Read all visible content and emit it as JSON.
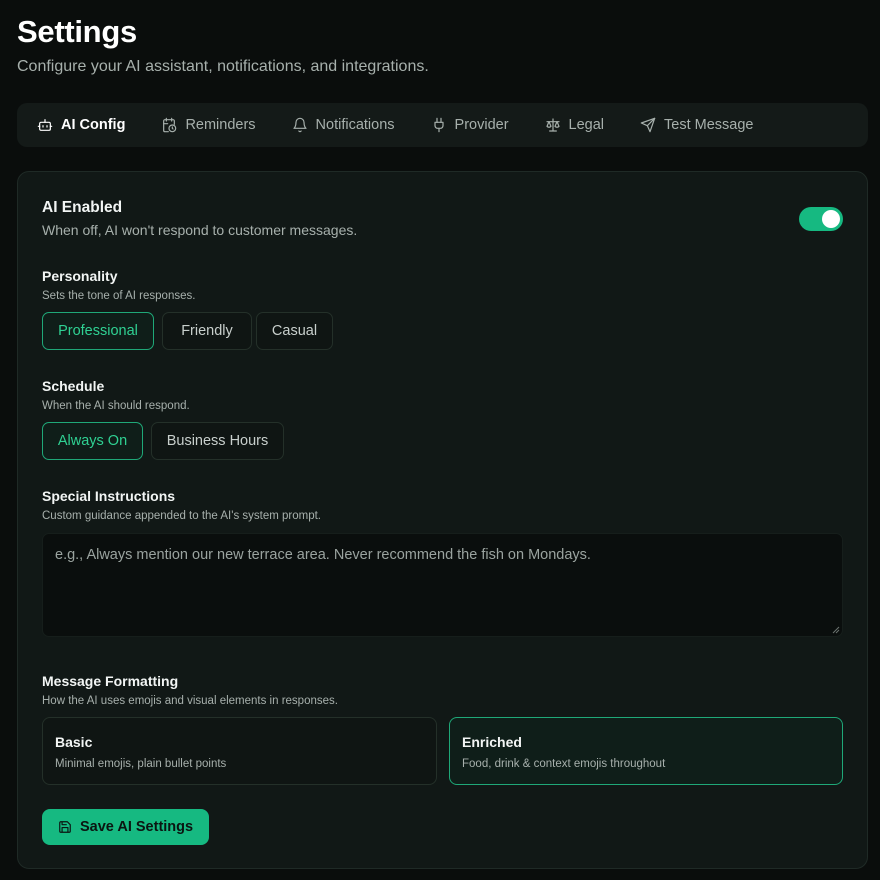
{
  "header": {
    "title": "Settings",
    "subtitle": "Configure your AI assistant, notifications, and integrations."
  },
  "tabs": [
    {
      "label": "AI Config",
      "icon": "bot-icon",
      "active": true
    },
    {
      "label": "Reminders",
      "icon": "calendar-clock-icon",
      "active": false
    },
    {
      "label": "Notifications",
      "icon": "bell-icon",
      "active": false
    },
    {
      "label": "Provider",
      "icon": "plug-icon",
      "active": false
    },
    {
      "label": "Legal",
      "icon": "scale-icon",
      "active": false
    },
    {
      "label": "Test Message",
      "icon": "send-icon",
      "active": false
    }
  ],
  "ai_enabled": {
    "title": "AI Enabled",
    "description": "When off, AI won't respond to customer messages.",
    "value": true
  },
  "personality": {
    "title": "Personality",
    "description": "Sets the tone of AI responses.",
    "options": [
      "Professional",
      "Friendly",
      "Casual"
    ],
    "selected": "Professional"
  },
  "schedule": {
    "title": "Schedule",
    "description": "When the AI should respond.",
    "options": [
      "Always On",
      "Business Hours"
    ],
    "selected": "Always On"
  },
  "special_instructions": {
    "title": "Special Instructions",
    "description": "Custom guidance appended to the AI's system prompt.",
    "placeholder": "e.g., Always mention our new terrace area. Never recommend the fish on Mondays.",
    "value": ""
  },
  "message_formatting": {
    "title": "Message Formatting",
    "description": "How the AI uses emojis and visual elements in responses.",
    "options": [
      {
        "title": "Basic",
        "description": "Minimal emojis, plain bullet points"
      },
      {
        "title": "Enriched",
        "description": "Food, drink & context emojis throughout"
      }
    ],
    "selected": "Enriched"
  },
  "save_button": {
    "label": "Save AI Settings",
    "icon": "save-icon"
  },
  "colors": {
    "accent": "#16b981",
    "background": "#0a0d0c",
    "panel": "#111816"
  }
}
